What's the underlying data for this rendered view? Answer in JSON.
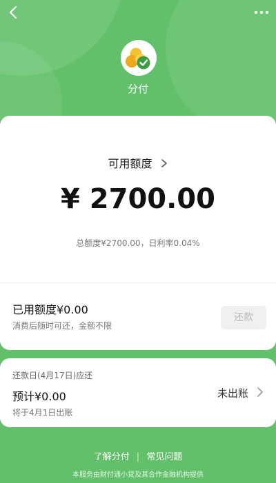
{
  "app": {
    "name": "分付"
  },
  "top_bar": {
    "back_icon": "chevron-left-icon",
    "more_icon": "more-dots-icon"
  },
  "credit": {
    "available_label": "可用额度",
    "available_amount": "¥ 2700.00",
    "summary": "总额度¥2700.00，日利率0.04%"
  },
  "used": {
    "title": "已用额度¥0.00",
    "subtitle": "消费后随时可还，金额不限",
    "repay_button": "还款"
  },
  "repayment": {
    "date_label": "还款日(4月17日)应还",
    "estimate": "预计¥0.00",
    "bill_date": "将于4月1日出账",
    "status": "未出账"
  },
  "links": {
    "learn": "了解分付",
    "faq": "常见问题"
  },
  "footer": {
    "text": "本服务由财付通小贷及其合作金融机构提供"
  },
  "colors": {
    "primary_green": "#62c06a",
    "card_white": "#ffffff",
    "link_accent": "#ffffff"
  }
}
